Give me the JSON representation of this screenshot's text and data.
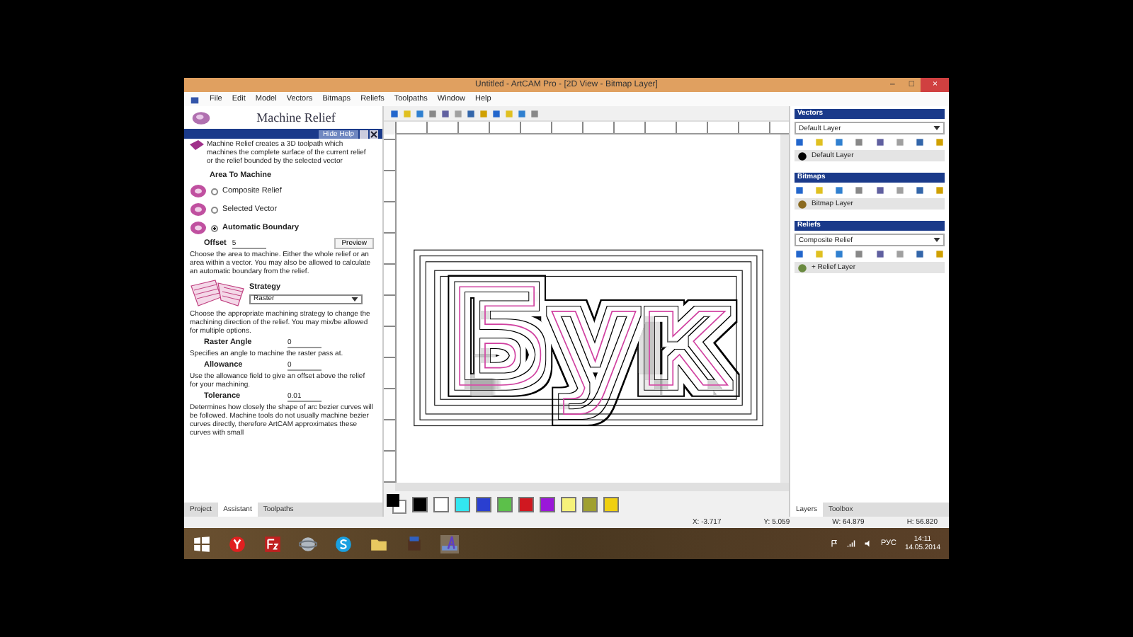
{
  "window": {
    "title": "Untitled - ArtCAM Pro - [2D View - Bitmap Layer]",
    "controls": [
      "–",
      "□",
      "×"
    ]
  },
  "menu": [
    "File",
    "Edit",
    "Model",
    "Vectors",
    "Bitmaps",
    "Reliefs",
    "Toolpaths",
    "Window",
    "Help"
  ],
  "assistant": {
    "title": "Machine Relief",
    "hide_help": "Hide Help",
    "intro": "Machine Relief creates a 3D toolpath which machines the complete surface of the current relief or the relief bounded by the selected vector",
    "area_heading": "Area To Machine",
    "areas": [
      {
        "label": "Composite Relief",
        "selected": false
      },
      {
        "label": "Selected Vector",
        "selected": false
      },
      {
        "label": "Automatic Boundary",
        "selected": true
      }
    ],
    "offset": {
      "label": "Offset",
      "value": "5"
    },
    "preview": "Preview",
    "offset_help": "Choose the area to machine. Either the whole relief or an area within a vector. You may also be allowed to calculate an automatic boundary from the relief.",
    "strategy": {
      "heading": "Strategy",
      "value": "Raster",
      "help": "Choose the appropriate machining strategy to change the machining direction of the relief. You may mix/be allowed for multiple options."
    },
    "params": [
      {
        "label": "Raster Angle",
        "value": "0",
        "help": "Specifies an angle to machine the raster pass at."
      },
      {
        "label": "Allowance",
        "value": "0",
        "help": "Use the allowance field to give an offset above the relief for your machining."
      },
      {
        "label": "Tolerance",
        "value": "0.01",
        "help": "Determines how closely the shape of arc bezier curves will be followed. Machine tools do not usually machine bezier curves directly, therefore ArtCAM approximates these curves with small"
      }
    ]
  },
  "left_tabs": [
    {
      "label": "Project",
      "selected": false
    },
    {
      "label": "Assistant",
      "selected": true
    },
    {
      "label": "Toolpaths",
      "selected": false
    }
  ],
  "canvas": {
    "text": "Бук"
  },
  "palette": [
    {
      "color": "#000000"
    },
    {
      "color": "#ffffff"
    },
    {
      "color": "#33e6f0"
    },
    {
      "color": "#2a3fd0"
    },
    {
      "color": "#5cc04a"
    },
    {
      "color": "#d01820"
    },
    {
      "color": "#9a18d8"
    },
    {
      "color": "#f6f27a"
    },
    {
      "color": "#a0a030"
    },
    {
      "color": "#f0d010"
    }
  ],
  "layers": [
    {
      "title": "Vectors",
      "dropdown": "Default Layer",
      "rows": [
        {
          "label": "Default Layer",
          "kind": "vector"
        }
      ]
    },
    {
      "title": "Bitmaps",
      "rows": [
        {
          "label": "Bitmap Layer",
          "kind": "bitmap"
        }
      ]
    },
    {
      "title": "Reliefs",
      "dropdown": "Composite Relief",
      "rows": [
        {
          "label": "+ Relief Layer",
          "kind": "relief"
        }
      ]
    }
  ],
  "right_tabs": [
    {
      "label": "Layers",
      "selected": true
    },
    {
      "label": "Toolbox",
      "selected": false
    }
  ],
  "status_bar": [
    "X: -3.717",
    "Y: 5.059",
    "W: 64.879",
    "H: 56.820"
  ],
  "taskbar": {
    "language": "РУС",
    "time": "14:11",
    "date": "14.05.2014"
  }
}
